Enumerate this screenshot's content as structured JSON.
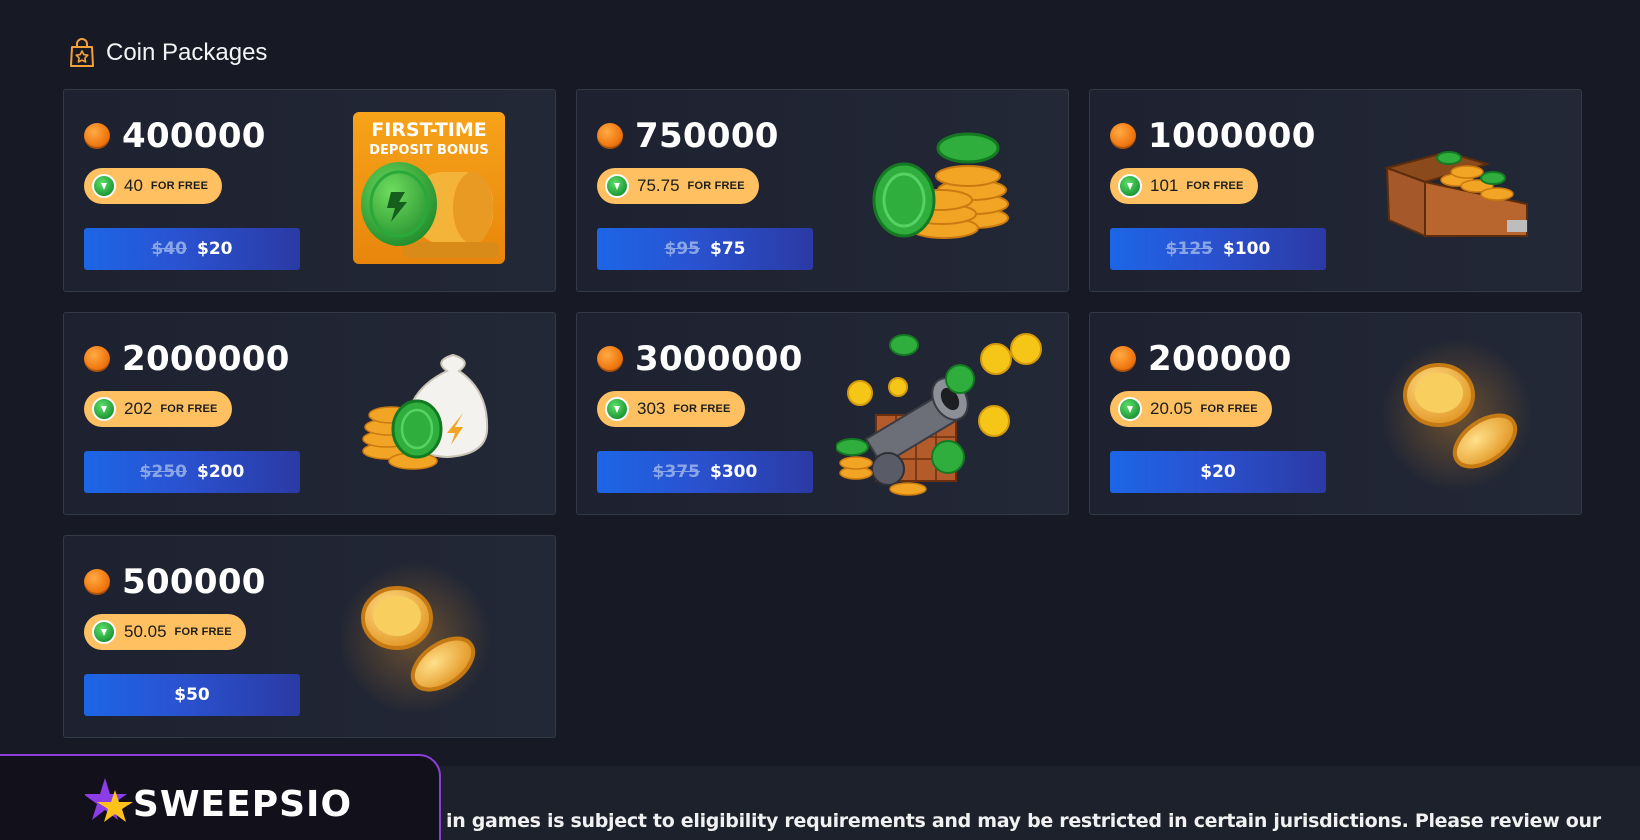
{
  "section": {
    "title": "Coin Packages",
    "icon": "shopping-bag-star-icon"
  },
  "packages": [
    {
      "amount": "400000",
      "bonus": "40",
      "bonus_suffix": "FOR FREE",
      "old_price": "$40",
      "price": "$20",
      "art": "first-time-deposit-bonus",
      "art_text_1": "FIRST-TIME",
      "art_text_2": "DEPOSIT BONUS"
    },
    {
      "amount": "750000",
      "bonus": "75.75",
      "bonus_suffix": "FOR FREE",
      "old_price": "$95",
      "price": "$75",
      "art": "coin-stacks"
    },
    {
      "amount": "1000000",
      "bonus": "101",
      "bonus_suffix": "FOR FREE",
      "old_price": "$125",
      "price": "$100",
      "art": "treasure-chest"
    },
    {
      "amount": "2000000",
      "bonus": "202",
      "bonus_suffix": "FOR FREE",
      "old_price": "$250",
      "price": "$200",
      "art": "money-bag"
    },
    {
      "amount": "3000000",
      "bonus": "303",
      "bonus_suffix": "FOR FREE",
      "old_price": "$375",
      "price": "$300",
      "art": "coin-cannon"
    },
    {
      "amount": "200000",
      "bonus": "20.05",
      "bonus_suffix": "FOR FREE",
      "old_price": "",
      "price": "$20",
      "art": "two-gold-coins"
    },
    {
      "amount": "500000",
      "bonus": "50.05",
      "bonus_suffix": "FOR FREE",
      "old_price": "",
      "price": "$50",
      "art": "two-gold-coins"
    }
  ],
  "footer": {
    "brand": "SWEEPSIO",
    "disclaimer": "in games is subject to eligibility requirements and may be restricted in certain jurisdictions. Please review our"
  },
  "colors": {
    "background": "#171a24",
    "card": "#1e2230",
    "bonus_pill": "#fec061",
    "button_start": "#1c66e6",
    "button_end": "#2b3aa4",
    "coin_orange": "#f27a12",
    "brand_border": "#8a3fd9"
  }
}
